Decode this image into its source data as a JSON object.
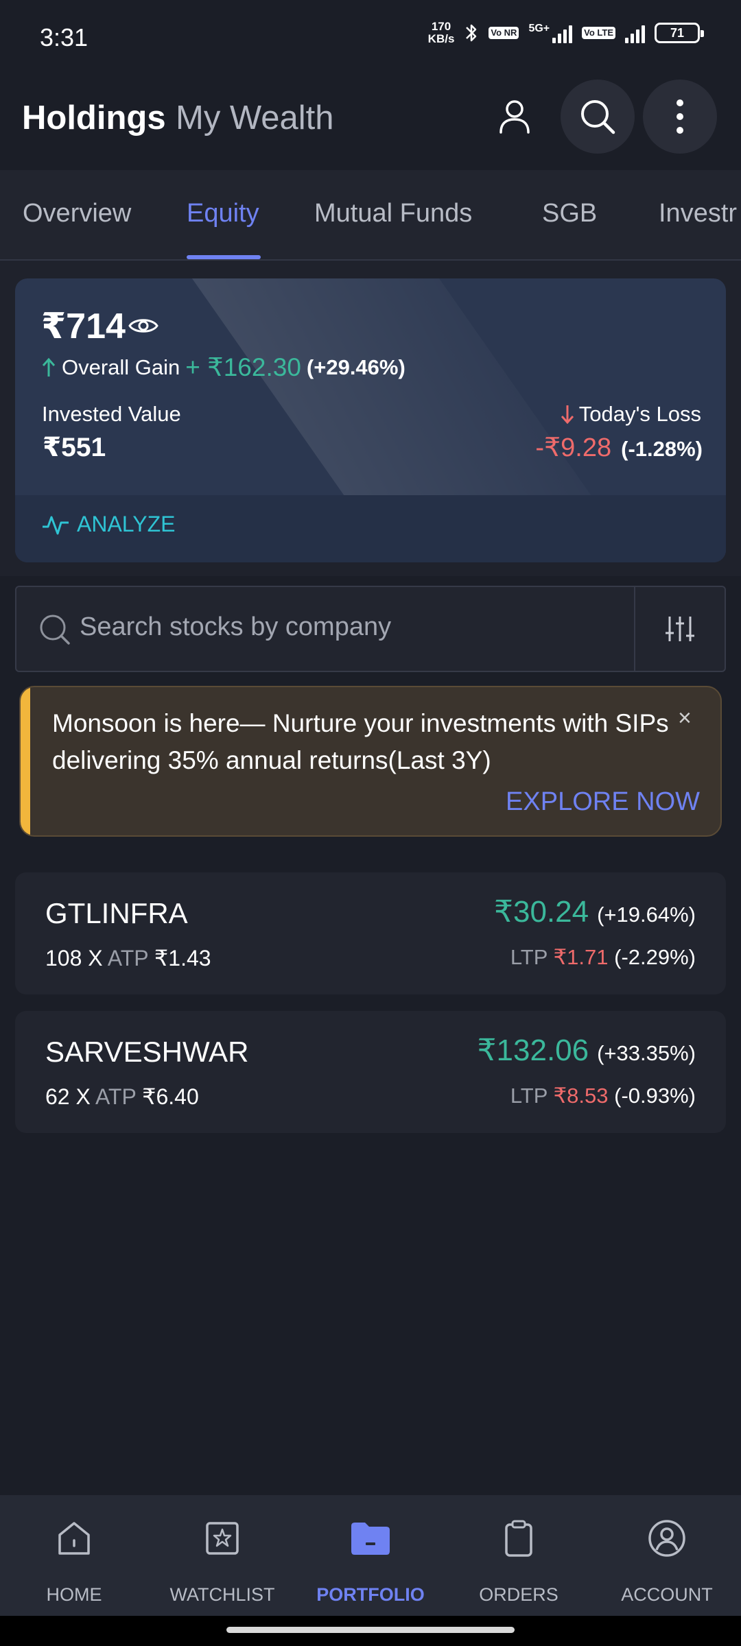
{
  "status_bar": {
    "time": "3:31",
    "net_speed_value": "170",
    "net_speed_unit": "KB/s",
    "sim1_badge": "Vo NR",
    "sim1_network": "5G+",
    "sim2_badge": "Vo LTE",
    "battery": "71"
  },
  "header": {
    "title": "Holdings",
    "subtitle": "My Wealth"
  },
  "tabs": [
    {
      "label": "Overview",
      "active": false
    },
    {
      "label": "Equity",
      "active": true
    },
    {
      "label": "Mutual Funds",
      "active": false
    },
    {
      "label": "SGB",
      "active": false
    },
    {
      "label": "Investr",
      "active": false
    }
  ],
  "summary": {
    "current_value": "₹714",
    "gain_label": "Overall Gain",
    "gain_amount": "+ ₹162.30",
    "gain_pct": "(+29.46%)",
    "invested_label": "Invested Value",
    "invested_value": "₹551",
    "loss_label": "Today's Loss",
    "loss_amount": "-₹9.28",
    "loss_pct": "(-1.28%)",
    "analyze_label": "ANALYZE"
  },
  "search": {
    "placeholder": "Search stocks by company"
  },
  "promo": {
    "text": "Monsoon is here— Nurture your investments with SIPs delivering 35% annual returns(Last 3Y)",
    "close": "×",
    "cta": "EXPLORE NOW"
  },
  "holdings": [
    {
      "symbol": "GTLINFRA",
      "qty": "108 X",
      "atp_label": "ATP",
      "atp_value": "₹1.43",
      "gain_amount": "₹30.24",
      "gain_pct": "(+19.64%)",
      "ltp_label": "LTP",
      "ltp_value": "₹1.71",
      "ltp_pct": "(-2.29%)"
    },
    {
      "symbol": "SARVESHWAR",
      "qty": "62 X",
      "atp_label": "ATP",
      "atp_value": "₹6.40",
      "gain_amount": "₹132.06",
      "gain_pct": "(+33.35%)",
      "ltp_label": "LTP",
      "ltp_value": "₹8.53",
      "ltp_pct": "(-0.93%)"
    }
  ],
  "bottom_nav": [
    {
      "label": "HOME",
      "icon": "home-icon",
      "active": false
    },
    {
      "label": "WATCHLIST",
      "icon": "watchlist-icon",
      "active": false
    },
    {
      "label": "PORTFOLIO",
      "icon": "portfolio-icon",
      "active": true
    },
    {
      "label": "ORDERS",
      "icon": "orders-icon",
      "active": false
    },
    {
      "label": "ACCOUNT",
      "icon": "account-icon",
      "active": false
    }
  ],
  "colors": {
    "background": "#1b1e27",
    "accent": "#6f82f2",
    "gain": "#3bb89b",
    "loss": "#ef6b6b",
    "analyze": "#2fc4d4",
    "promo_accent": "#f2b63c"
  }
}
